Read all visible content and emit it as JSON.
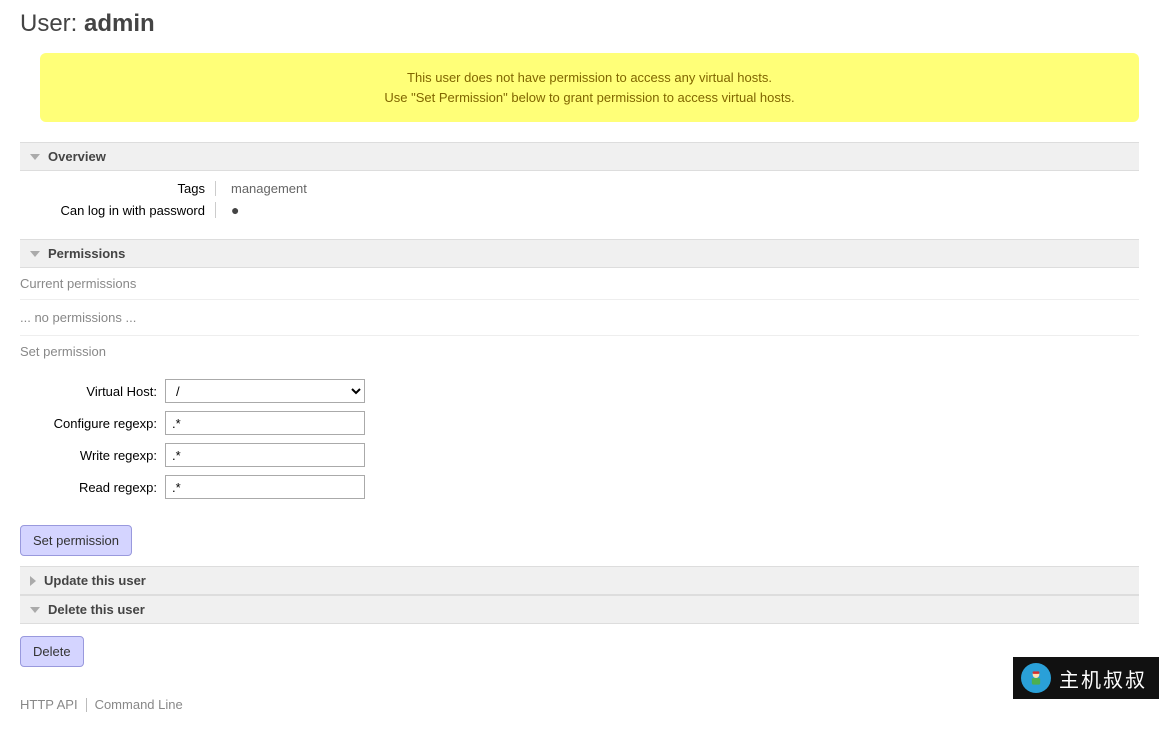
{
  "page_title_prefix": "User: ",
  "page_title_user": "admin",
  "warning_line1": "This user does not have permission to access any virtual hosts.",
  "warning_line2": "Use \"Set Permission\" below to grant permission to access virtual hosts.",
  "sections": {
    "overview": {
      "title": "Overview",
      "rows": {
        "tags_label": "Tags",
        "tags_value": "management",
        "pw_label": "Can log in with password",
        "pw_value": "●"
      }
    },
    "permissions": {
      "title": "Permissions",
      "current_heading": "Current permissions",
      "no_permissions": "... no permissions ...",
      "set_heading": "Set permission",
      "form": {
        "vhost_label": "Virtual Host:",
        "vhost_selected": "/",
        "vhost_options": [
          "/"
        ],
        "configure_label": "Configure regexp:",
        "configure_value": ".*",
        "write_label": "Write regexp:",
        "write_value": ".*",
        "read_label": "Read regexp:",
        "read_value": ".*",
        "submit_label": "Set permission"
      }
    },
    "update": {
      "title": "Update this user"
    },
    "delete": {
      "title": "Delete this user",
      "button": "Delete"
    }
  },
  "footer": {
    "api": "HTTP API",
    "cli": "Command Line"
  },
  "brand": {
    "text": "主机叔叔"
  }
}
